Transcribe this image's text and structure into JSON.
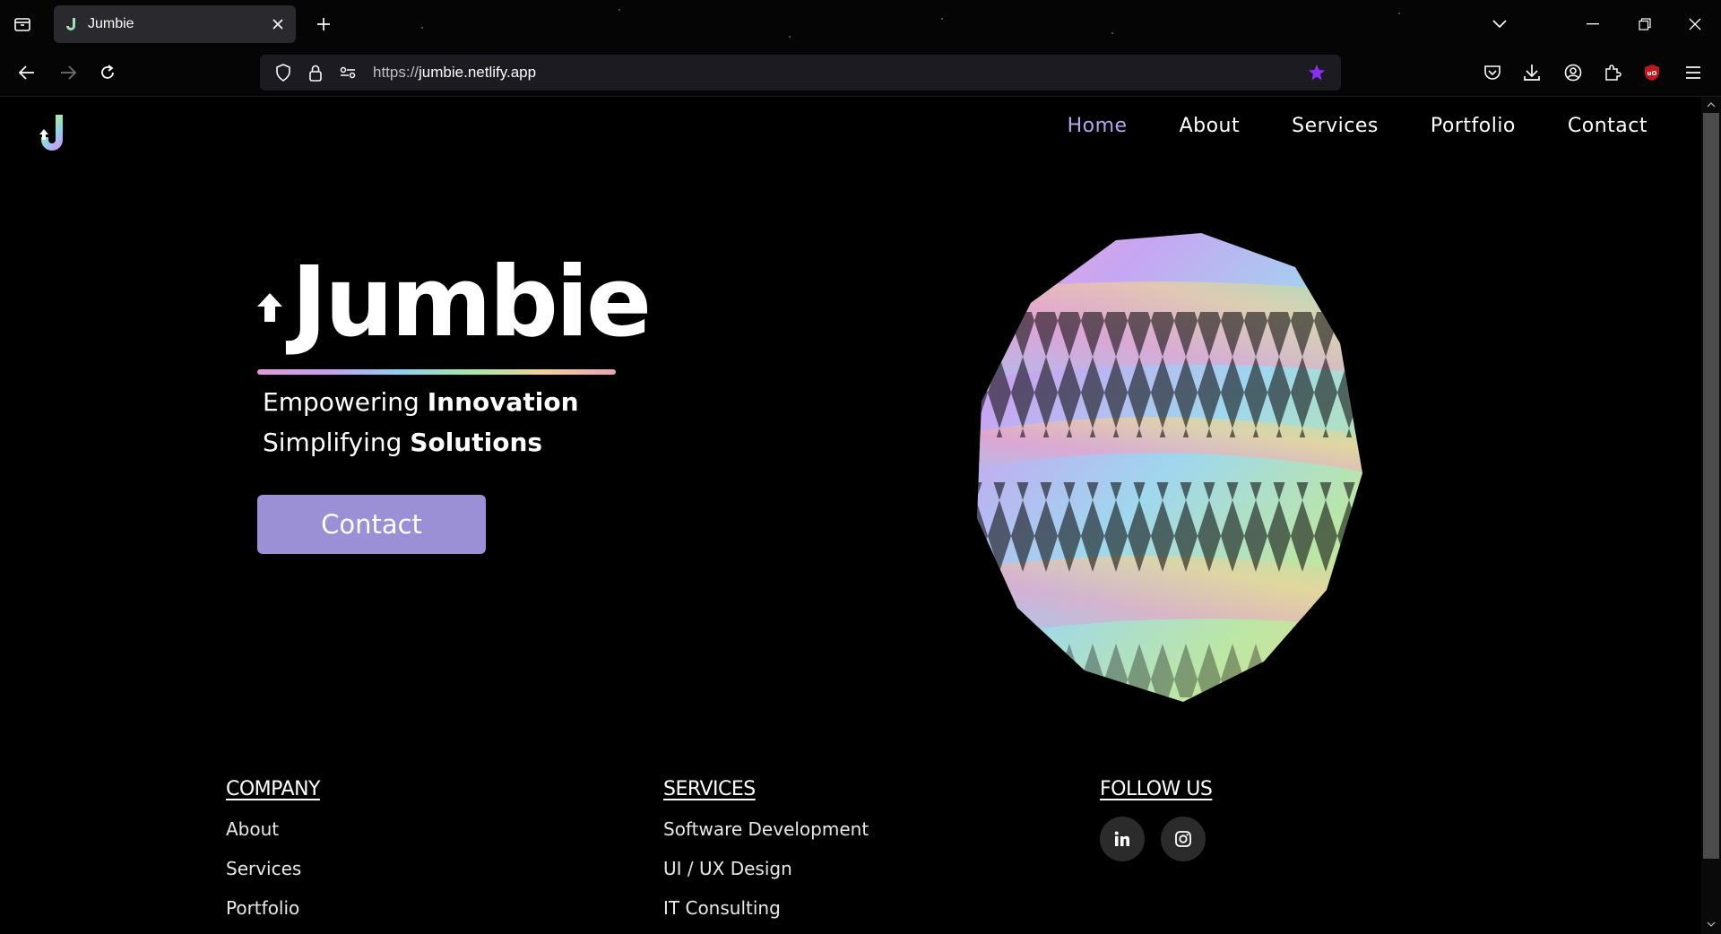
{
  "browser": {
    "tab_title": "Jumbie",
    "url_prefix": "https://",
    "url_host": "jumbie.netlify.app",
    "accent_star": "#8b2ef5",
    "ublock_color": "#c4171d"
  },
  "site": {
    "logo_letter": "J",
    "nav": [
      {
        "label": "Home",
        "active": true
      },
      {
        "label": "About",
        "active": false
      },
      {
        "label": "Services",
        "active": false
      },
      {
        "label": "Portfolio",
        "active": false
      },
      {
        "label": "Contact",
        "active": false
      }
    ],
    "active_color": "#b7a6ea"
  },
  "hero": {
    "title": "Jumbie",
    "line1_regular": "Empowering ",
    "line1_bold": "Innovation",
    "line2_regular": "Simplifying ",
    "line2_bold": "Solutions",
    "cta_label": "Contact",
    "cta_color": "#9b8fd6"
  },
  "footer": {
    "company": {
      "heading": "COMPANY",
      "links": [
        "About",
        "Services",
        "Portfolio"
      ]
    },
    "services": {
      "heading": "SERVICES",
      "links": [
        "Software Development",
        "UI / UX Design",
        "IT Consulting"
      ]
    },
    "follow": {
      "heading": "FOLLOW US",
      "icons": [
        "linkedin-icon",
        "instagram-icon"
      ]
    }
  }
}
